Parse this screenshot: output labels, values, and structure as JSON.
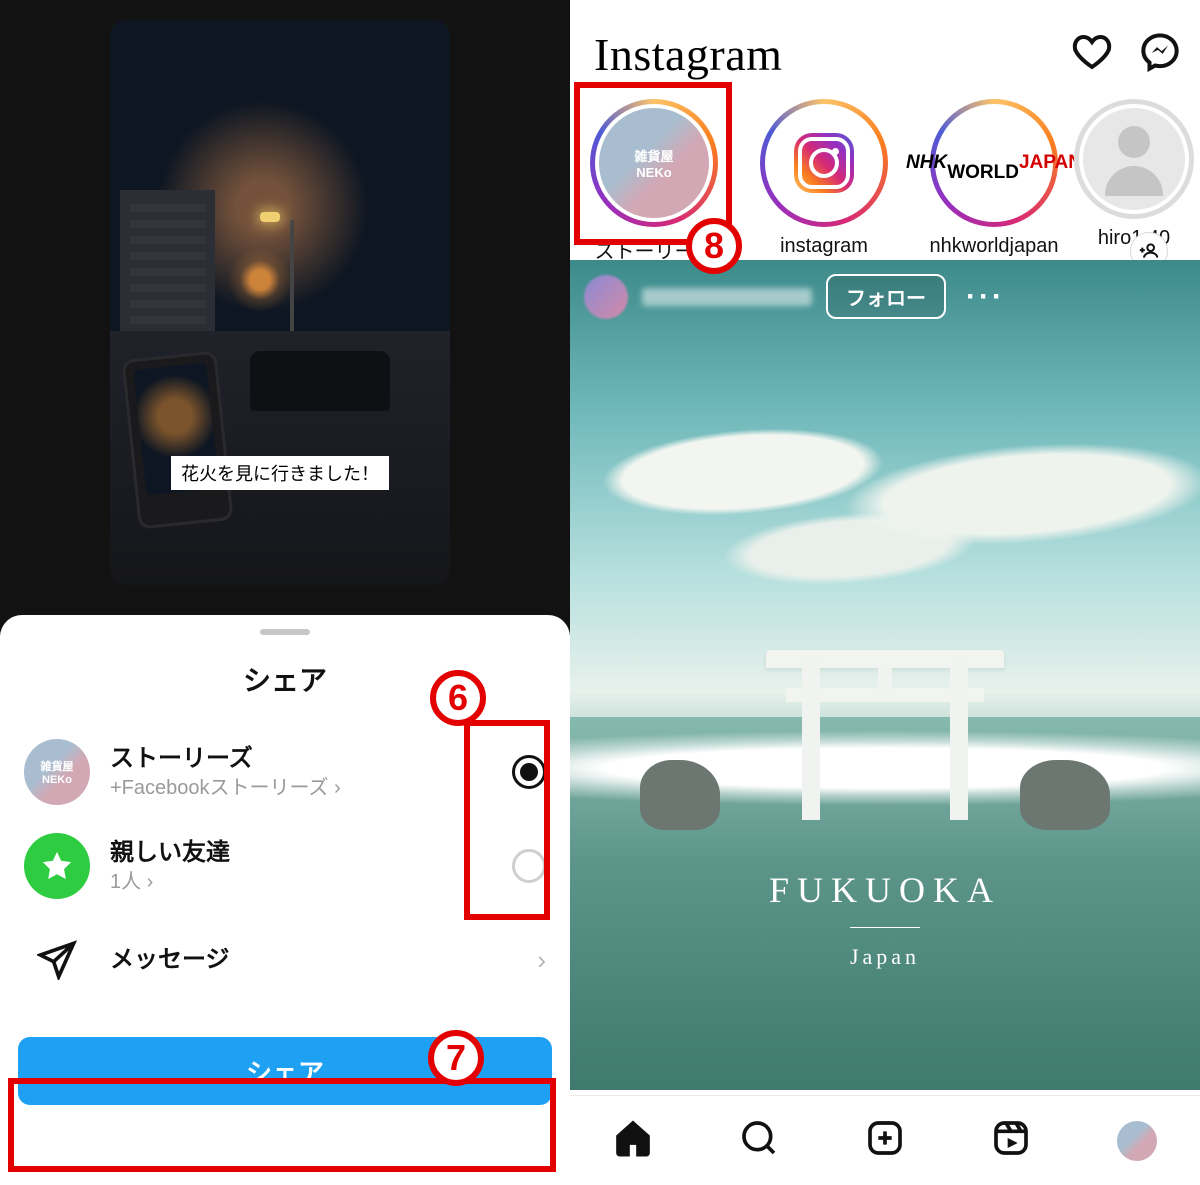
{
  "annotations": {
    "step6": "6",
    "step7": "7",
    "step8": "8"
  },
  "left": {
    "story_caption": "花火を見に行きました！",
    "sheet_title": "シェア",
    "rows": {
      "stories": {
        "name": "ストーリーズ",
        "sub": "+Facebookストーリーズ ›"
      },
      "close_friends": {
        "name": "親しい友達",
        "sub": "1人 ›"
      },
      "messages": {
        "name": "メッセージ"
      }
    },
    "share_button": "シェア"
  },
  "right": {
    "logo": "Instagram",
    "stories": [
      {
        "label": "ストーリーズ",
        "kind": "me",
        "text": "雑貨屋\nNEKo"
      },
      {
        "label": "instagram",
        "kind": "ig"
      },
      {
        "label": "nhkworldjapan",
        "kind": "nhk"
      },
      {
        "label": "hiro1.40",
        "kind": "placeholder"
      }
    ],
    "post": {
      "follow": "フォロー",
      "caption_main": "FUKUOKA",
      "caption_sub": "Japan"
    }
  }
}
